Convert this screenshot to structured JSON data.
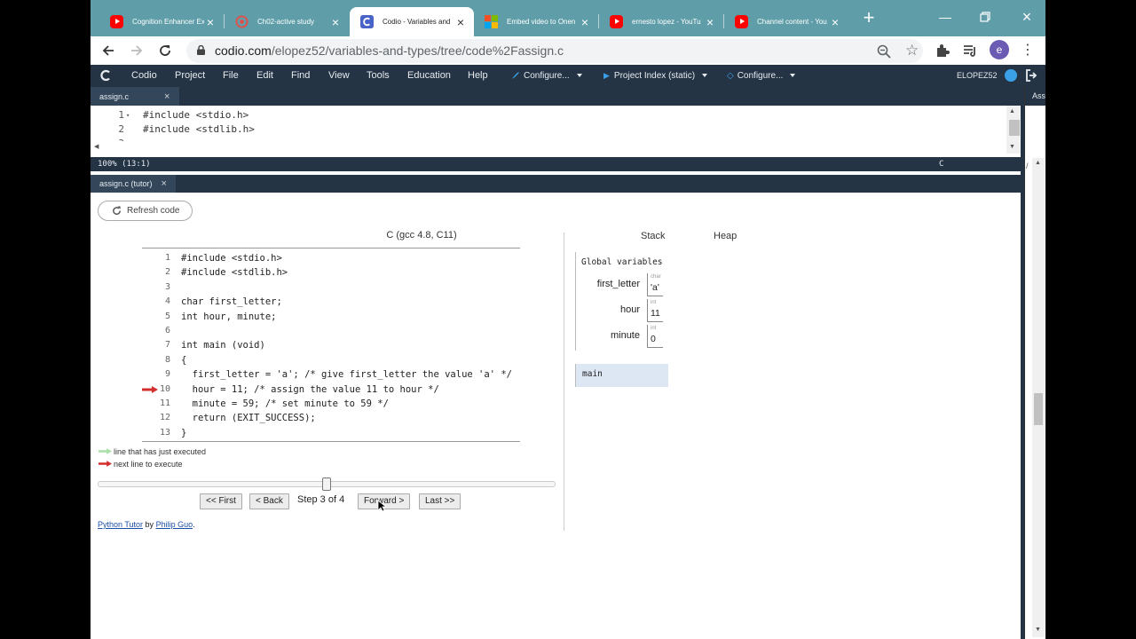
{
  "browser": {
    "tabs": [
      {
        "title": "Cognition Enhancer Ex",
        "icon": "youtube-icon"
      },
      {
        "title": "Ch02-active study",
        "icon": "study-icon"
      },
      {
        "title": "Codio - Variables and",
        "icon": "codio-icon"
      },
      {
        "title": "Embed video to Onen",
        "icon": "microsoft-icon"
      },
      {
        "title": "ernesto lopez - YouTu",
        "icon": "youtube-icon"
      },
      {
        "title": "Channel content - You",
        "icon": "youtube-icon"
      }
    ],
    "url_host": "codio.com",
    "url_path": "/elopez52/variables-and-types/tree/code%2Fassign.c",
    "avatar_letter": "e"
  },
  "codio": {
    "menu": [
      "Codio",
      "Project",
      "File",
      "Edit",
      "Find",
      "View",
      "Tools",
      "Education",
      "Help"
    ],
    "configure1": "Configure...",
    "project_index": "Project Index (static)",
    "configure2": "Configure...",
    "user": "ELOPEZ52",
    "right_tab": "Assi"
  },
  "editor": {
    "tab": "assign.c",
    "lines": [
      {
        "num": "1",
        "code": "#include <stdio.h>"
      },
      {
        "num": "2",
        "code": "#include <stdlib.h>"
      },
      {
        "num": "3",
        "code": ""
      }
    ],
    "status": "100%  (13:1)",
    "language": "C"
  },
  "tutor": {
    "tab": "assign.c (tutor)",
    "refresh": "Refresh code",
    "language": "C (gcc 4.8, C11)",
    "code": [
      {
        "num": "1",
        "text": "#include <stdio.h>"
      },
      {
        "num": "2",
        "text": "#include <stdlib.h>"
      },
      {
        "num": "3",
        "text": ""
      },
      {
        "num": "4",
        "text": "char first_letter;"
      },
      {
        "num": "5",
        "text": "int hour, minute;"
      },
      {
        "num": "6",
        "text": ""
      },
      {
        "num": "7",
        "text": "int main (void)"
      },
      {
        "num": "8",
        "text": "{"
      },
      {
        "num": "9",
        "text": "  first_letter = 'a'; /* give first_letter the value 'a' */"
      },
      {
        "num": "10",
        "text": "  hour = 11; /* assign the value 11 to hour */"
      },
      {
        "num": "11",
        "text": "  minute = 59; /* set minute to 59 */"
      },
      {
        "num": "12",
        "text": "  return (EXIT_SUCCESS);"
      },
      {
        "num": "13",
        "text": "}"
      }
    ],
    "current_line": 10,
    "legend_executed": "line that has just executed",
    "legend_next": "next line to execute",
    "legend_executed_color": "#a8e0a8",
    "legend_next_color": "#d32f2f",
    "step_fraction": 0.5,
    "buttons": {
      "first": "<< First",
      "back": "< Back",
      "forward": "Forward >",
      "last": "Last >>"
    },
    "step_label": "Step 3 of 4",
    "credit_link1": "Python Tutor",
    "credit_by": "by",
    "credit_link2": "Philip Guo",
    "credit_end": ".",
    "stack_heading": "Stack",
    "heap_heading": "Heap",
    "globals_title": "Global variables",
    "globals": [
      {
        "name": "first_letter",
        "type": "char",
        "value": "'a'"
      },
      {
        "name": "hour",
        "type": "int",
        "value": "11"
      },
      {
        "name": "minute",
        "type": "int",
        "value": "0"
      }
    ],
    "frame": "main"
  },
  "colors": {
    "tabstrip": "#5f9ea8",
    "codio_bar": "#253445",
    "frame_highlight": "#dde6f3"
  }
}
